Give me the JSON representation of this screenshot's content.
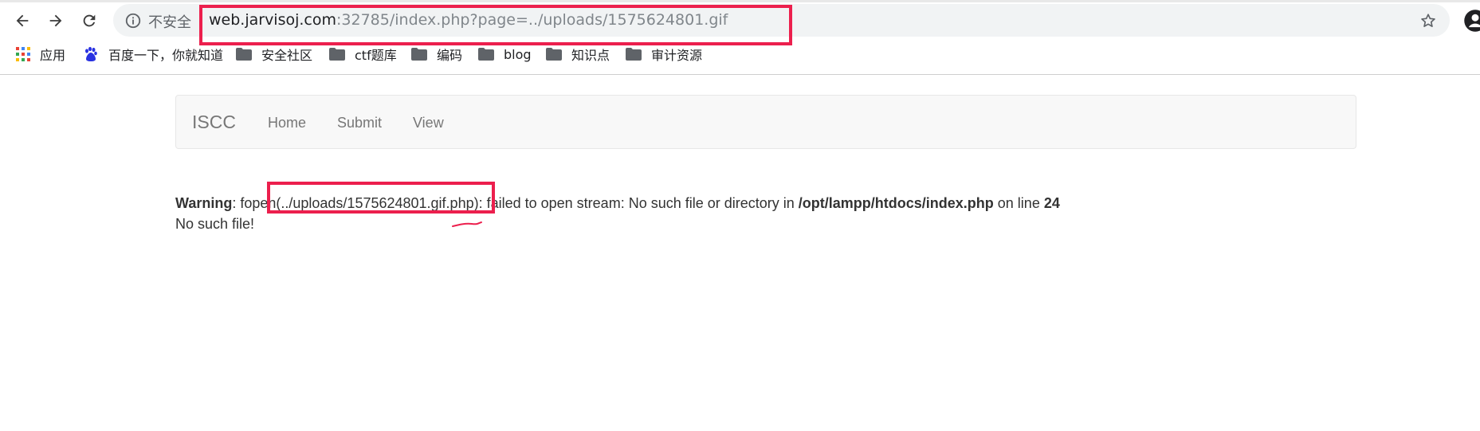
{
  "browser": {
    "security_label": "不安全",
    "url_host": "web.jarvisoj.com",
    "url_rest": ":32785/index.php?page=../uploads/1575624801.gif",
    "bookmarks": [
      {
        "label": "应用",
        "icon": "apps-grid-icon"
      },
      {
        "label": "百度一下，你就知道",
        "icon": "baidu-paw-icon"
      },
      {
        "label": "安全社区",
        "icon": "folder-icon"
      },
      {
        "label": "ctf题库",
        "icon": "folder-icon"
      },
      {
        "label": "编码",
        "icon": "folder-icon"
      },
      {
        "label": "blog",
        "icon": "folder-icon"
      },
      {
        "label": "知识点",
        "icon": "folder-icon"
      },
      {
        "label": "审计资源",
        "icon": "folder-icon"
      }
    ]
  },
  "navbar": {
    "brand": "ISCC",
    "links": [
      "Home",
      "Submit",
      "View"
    ]
  },
  "message": {
    "warning_label": "Warning",
    "sep1": ": fopen(",
    "path": "../uploads/1575624801.gif.php",
    "sep2": "): failed to open stream: No such file or directory in ",
    "file": "/opt/lampp/htdocs/index.php",
    "sep3": " on line ",
    "line": "24",
    "second_line": "No such file!"
  },
  "colors": {
    "highlight": "#ec1f4d",
    "navbar_bg": "#f8f8f8"
  }
}
